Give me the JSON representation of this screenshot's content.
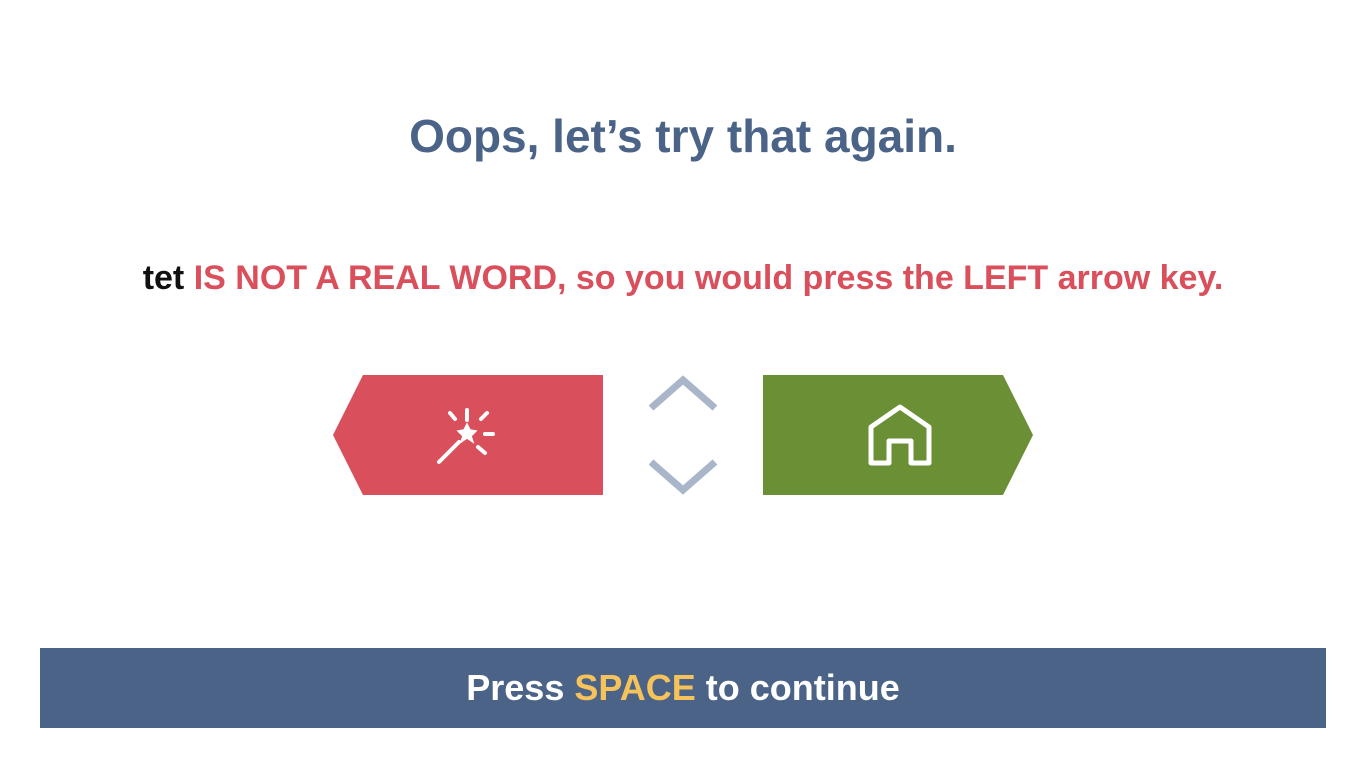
{
  "heading": "Oops, let’s try that again.",
  "feedback": {
    "word": "tet",
    "message": "IS NOT A REAL WORD, so you would press the LEFT arrow key."
  },
  "keys": {
    "left": {
      "icon": "magic-wand-icon",
      "color": "#d94f5c"
    },
    "right": {
      "icon": "house-icon",
      "color": "#6a8f35"
    },
    "up": {
      "icon": "chevron-up-icon",
      "color": "#a9b5c8"
    },
    "down": {
      "icon": "chevron-down-icon",
      "color": "#a9b5c8"
    }
  },
  "continue_bar": {
    "prefix": "Press",
    "key": "SPACE",
    "suffix": "to continue",
    "background": "#4a6387",
    "key_color": "#f5c25b"
  }
}
